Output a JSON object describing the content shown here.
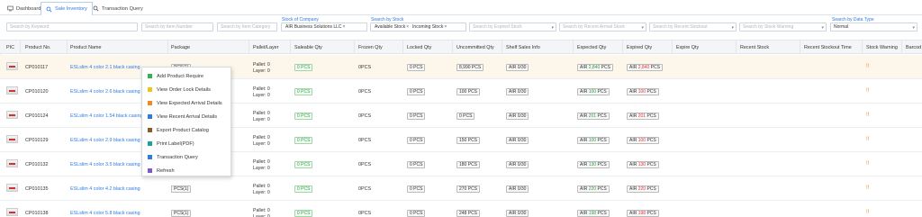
{
  "tabs": [
    {
      "label": "Dashboard",
      "icon": "monitor-icon"
    },
    {
      "label": "Sale Inventory",
      "icon": "search-icon"
    },
    {
      "label": "Transaction Query",
      "icon": "search-icon"
    }
  ],
  "filters": {
    "keyword_placeholder": "Search by Keyword",
    "item_number_placeholder": "Search by Item Number",
    "item_category_placeholder": "Search by Item Category",
    "stock_of_company_label": "Stock of Company",
    "stock_of_company_value": "AIR Business Solutions LLC",
    "search_by_stock_label": "Search by Stock",
    "stock_chip_1": "Available Stock",
    "stock_chip_2": "Incoming Stock",
    "expired_stock_placeholder": "Search by Expired Stock",
    "recent_arrival_placeholder": "Search by Recent Arrival Stock",
    "recent_stockout_placeholder": "Search by Recent Stockout",
    "stock_warning_placeholder": "Search by Stock Warning",
    "data_type_label": "Search by Data Type",
    "data_type_value": "Normal",
    "remove_symbol": "×",
    "caret_symbol": "▾"
  },
  "columns": {
    "pic": "PIC",
    "product_no": "Product No.",
    "product_name": "Product Name",
    "package": "Package",
    "pallet_layer": "Pallet/Layer",
    "saleable_qty": "Saleable Qty",
    "frozen_qty": "Frozen Qty",
    "locked_qty": "Locked Qty",
    "uncommitted_qty": "Uncommitted Qty",
    "shelf_sales_info": "Shelf Sales Info",
    "expected_qty": "Expected Qty",
    "expired_qty": "Expired Qty",
    "expire_qty": "Expire Qty",
    "recent_stock": "Recent Stock",
    "recent_stockout_time": "Recent Stockout Time",
    "stock_warning": "Stock Warning",
    "barcode": "Barcod"
  },
  "pallet_label": "Pallet: 0",
  "layer_label": "Layer: 0",
  "shelf_prefix": "AIR",
  "pcs_suffix": "PCS",
  "rows": [
    {
      "no": "CP010117",
      "name": "ESLslim 4 color 2.1 black casing",
      "package": "PCS(1)",
      "saleable": "0 PCS",
      "frozen": "0PCS",
      "locked": "0 PCS",
      "uncommitted": "8,990 PCS",
      "shelf": "AIR 0/30",
      "expected": "2,840",
      "expired": "2,840",
      "warning": "!!"
    },
    {
      "no": "CP010120",
      "name": "ESLslim 4 color 2.6 black casing",
      "package": "PCS(1)",
      "saleable": "0 PCS",
      "frozen": "0PCS",
      "locked": "0 PCS",
      "uncommitted": "100 PCS",
      "shelf": "AIR 0/30",
      "expected": "100",
      "expired": "100",
      "warning": "!!"
    },
    {
      "no": "CP010124",
      "name": "ESLslim 4 color 1.54 black casing",
      "package": "PCS(1)",
      "saleable": "0 PCS",
      "frozen": "0PCS",
      "locked": "0 PCS",
      "uncommitted": "0 PCS",
      "shelf": "AIR 0/30",
      "expected": "201",
      "expired": "201",
      "warning": "!!"
    },
    {
      "no": "CP010129",
      "name": "ESLslim 4 color 2.9 black casing",
      "package": "PCS(1)",
      "saleable": "0 PCS",
      "frozen": "0PCS",
      "locked": "0 PCS",
      "uncommitted": "150 PCS",
      "shelf": "AIR 0/30",
      "expected": "100",
      "expired": "100",
      "warning": "!!"
    },
    {
      "no": "CP010132",
      "name": "ESLslim 4 color 3.5 black casing",
      "package": "PCS(1)",
      "saleable": "0 PCS",
      "frozen": "0PCS",
      "locked": "0 PCS",
      "uncommitted": "180 PCS",
      "shelf": "AIR 0/30",
      "expected": "130",
      "expired": "130",
      "warning": "!!"
    },
    {
      "no": "CP010135",
      "name": "ESLslim 4 color 4.2 black casing",
      "package": "PCS(1)",
      "saleable": "0 PCS",
      "frozen": "0PCS",
      "locked": "0 PCS",
      "uncommitted": "270 PCS",
      "shelf": "AIR 0/30",
      "expected": "220",
      "expired": "220",
      "warning": "!!"
    },
    {
      "no": "CP010138",
      "name": "ESLslim 4 color 5.8 black casing",
      "package": "PCS(1)",
      "saleable": "0 PCS",
      "frozen": "0PCS",
      "locked": "0 PCS",
      "uncommitted": "248 PCS",
      "shelf": "AIR 0/30",
      "expected": "198",
      "expired": "198",
      "warning": "!!"
    }
  ],
  "context_menu": [
    {
      "label": "Add Product Require",
      "color": "#3cb04b"
    },
    {
      "label": "View Order Lock Details",
      "color": "#f2c218"
    },
    {
      "label": "View Expected Arrival Details",
      "color": "#f08a1c"
    },
    {
      "label": "View Recent Arrival Details",
      "color": "#2d7be5"
    },
    {
      "label": "Export Product Catalog",
      "color": "#8a5a2b"
    },
    {
      "label": "Print Label(PDF)",
      "color": "#1aa39a"
    },
    {
      "label": "Transaction Query",
      "color": "#2d7be5"
    },
    {
      "label": "Refresh",
      "color": "#7b5cc4"
    }
  ],
  "colors": {
    "accent": "#2d7be5",
    "highlight_row": "#fdf6ea",
    "warning": "#f08a1c",
    "expected_green": "#2f9c3f",
    "expired_red": "#e03b3b"
  }
}
